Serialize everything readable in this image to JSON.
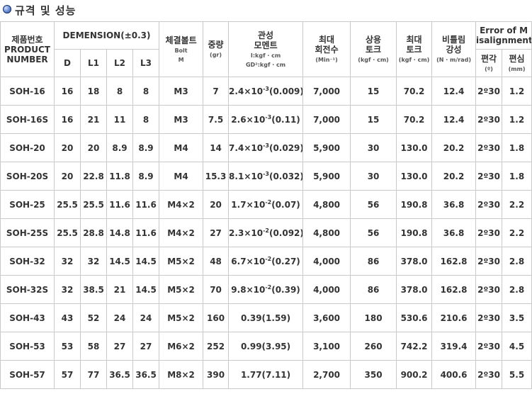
{
  "title": "규격 및 성능",
  "headers": {
    "product": [
      "제품번호",
      "PRODUCT",
      "NUMBER"
    ],
    "dimension": "DEMENSION(±0.3)",
    "dim_cols": [
      "D",
      "L1",
      "L2",
      "L3"
    ],
    "bolt": {
      "ko": "체결볼트",
      "en1": "Bolt",
      "en2": "M"
    },
    "weight": {
      "ko": "중량",
      "unit": "(gr)"
    },
    "inertia": {
      "ko1": "관성",
      "ko2": "모멘트",
      "unit1": "I:kgf · cm",
      "unit2": "GD²:kgf · cm"
    },
    "max_speed": {
      "ko1": "최대",
      "ko2": "회전수",
      "unit": "(Min⁻¹)"
    },
    "rated_torque": {
      "ko1": "상용",
      "ko2": "토크",
      "unit": "(kgf · cm)"
    },
    "max_torque": {
      "ko1": "최대",
      "ko2": "토크",
      "unit": "(kgf · cm)"
    },
    "torsional": {
      "ko1": "비틀림",
      "ko2": "강성",
      "unit": "(N · m/rad)"
    },
    "misalign": {
      "line1": "Error of M",
      "line2": "isalignment"
    },
    "angular": {
      "ko": "편각",
      "unit": "(º)"
    },
    "parallel": {
      "ko": "편심",
      "unit": "(mm)"
    }
  },
  "rows": [
    {
      "product": "SOH-16",
      "D": "16",
      "L1": "18",
      "L2": "8",
      "L3": "8",
      "bolt": "M3",
      "weight": "7",
      "inertia": {
        "mant": "2.4",
        "exp": "-3",
        "paren": "(0.009)"
      },
      "speed": "7,000",
      "rated": "15",
      "max": "70.2",
      "tors": "12.4",
      "ang": "2º30",
      "par": "1.2"
    },
    {
      "product": "SOH-16S",
      "D": "16",
      "L1": "21",
      "L2": "11",
      "L3": "8",
      "bolt": "M3",
      "weight": "7.5",
      "inertia": {
        "mant": "2.6",
        "exp": "-3",
        "paren": "(0.11)"
      },
      "speed": "7,000",
      "rated": "15",
      "max": "70.2",
      "tors": "12.4",
      "ang": "2º30",
      "par": "1.2"
    },
    {
      "product": "SOH-20",
      "D": "20",
      "L1": "20",
      "L2": "8.9",
      "L3": "8.9",
      "bolt": "M4",
      "weight": "14",
      "inertia": {
        "mant": "7.4",
        "exp": "-3",
        "paren": "(0.029)"
      },
      "speed": "5,900",
      "rated": "30",
      "max": "130.0",
      "tors": "20.2",
      "ang": "2º30",
      "par": "1.8"
    },
    {
      "product": "SOH-20S",
      "D": "20",
      "L1": "22.8",
      "L2": "11.8",
      "L3": "8.9",
      "bolt": "M4",
      "weight": "15.3",
      "inertia": {
        "mant": "8.1",
        "exp": "-3",
        "paren": "(0.032)"
      },
      "speed": "5,900",
      "rated": "30",
      "max": "130.0",
      "tors": "20.2",
      "ang": "2º30",
      "par": "1.8"
    },
    {
      "product": "SOH-25",
      "D": "25.5",
      "L1": "25.5",
      "L2": "11.6",
      "L3": "11.6",
      "bolt": "M4×2",
      "weight": "20",
      "inertia": {
        "mant": "1.7",
        "exp": "-2",
        "paren": "(0.07)"
      },
      "speed": "4,800",
      "rated": "56",
      "max": "190.8",
      "tors": "36.8",
      "ang": "2º30",
      "par": "2.2"
    },
    {
      "product": "SOH-25S",
      "D": "25.5",
      "L1": "28.8",
      "L2": "14.8",
      "L3": "11.6",
      "bolt": "M4×2",
      "weight": "27",
      "inertia": {
        "mant": "2.3",
        "exp": "-2",
        "paren": "(0.092)"
      },
      "speed": "4,800",
      "rated": "56",
      "max": "190.8",
      "tors": "36.8",
      "ang": "2º30",
      "par": "2.2"
    },
    {
      "product": "SOH-32",
      "D": "32",
      "L1": "32",
      "L2": "14.5",
      "L3": "14.5",
      "bolt": "M5×2",
      "weight": "48",
      "inertia": {
        "mant": "6.7",
        "exp": "-2",
        "paren": "(0.27)"
      },
      "speed": "4,000",
      "rated": "86",
      "max": "378.0",
      "tors": "162.8",
      "ang": "2º30",
      "par": "2.8"
    },
    {
      "product": "SOH-32S",
      "D": "32",
      "L1": "38.5",
      "L2": "21",
      "L3": "14.5",
      "bolt": "M5×2",
      "weight": "70",
      "inertia": {
        "mant": "9.8",
        "exp": "-2",
        "paren": "(0.39)"
      },
      "speed": "4,000",
      "rated": "86",
      "max": "378.0",
      "tors": "162.8",
      "ang": "2º30",
      "par": "2.8"
    },
    {
      "product": "SOH-43",
      "D": "43",
      "L1": "52",
      "L2": "24",
      "L3": "24",
      "bolt": "M5×2",
      "weight": "160",
      "inertia": {
        "plain": "0.39(1.59)"
      },
      "speed": "3,600",
      "rated": "180",
      "max": "530.6",
      "tors": "210.6",
      "ang": "2º30",
      "par": "3.5"
    },
    {
      "product": "SOH-53",
      "D": "53",
      "L1": "58",
      "L2": "27",
      "L3": "27",
      "bolt": "M6×2",
      "weight": "252",
      "inertia": {
        "plain": "0.99(3.95)"
      },
      "speed": "3,100",
      "rated": "260",
      "max": "742.2",
      "tors": "319.4",
      "ang": "2º30",
      "par": "4.5"
    },
    {
      "product": "SOH-57",
      "D": "57",
      "L1": "77",
      "L2": "36.5",
      "L3": "36.5",
      "bolt": "M8×2",
      "weight": "390",
      "inertia": {
        "plain": "1.77(7.11)"
      },
      "speed": "2,700",
      "rated": "350",
      "max": "900.2",
      "tors": "400.6",
      "ang": "2º30",
      "par": "5.5"
    }
  ]
}
